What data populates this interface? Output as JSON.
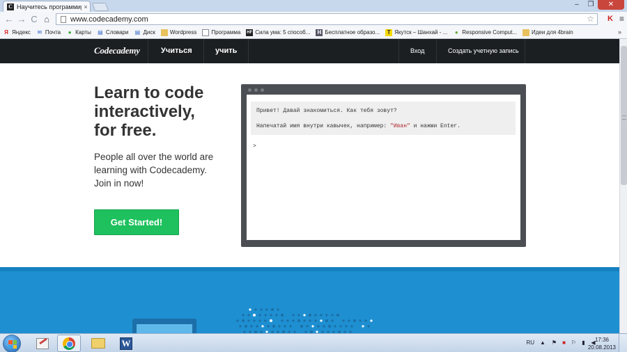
{
  "browser": {
    "tab_title": "Научитесь программиров",
    "tab_favicon": "C",
    "tab_close": "×",
    "url": "www.codecademy.com",
    "window_controls": [
      "–",
      "❐",
      "✕"
    ],
    "nav": {
      "back": "←",
      "forward": "→",
      "reload": "C",
      "home": "⌂"
    },
    "star": "☆",
    "ext_icon": "K",
    "menu_icon": "≡"
  },
  "bookmarks": [
    {
      "label": "Яндекс",
      "icon": "Я",
      "kind": "yandex"
    },
    {
      "label": "Почта",
      "icon": "✉",
      "kind": "page"
    },
    {
      "label": "Карты",
      "icon": "●",
      "kind": "maps"
    },
    {
      "label": "Словари",
      "icon": "▤",
      "kind": "page"
    },
    {
      "label": "Диск",
      "icon": "▤",
      "kind": "page"
    },
    {
      "label": "Wordpress",
      "icon": "",
      "kind": "folder"
    },
    {
      "label": "Программа",
      "icon": "",
      "kind": "page"
    },
    {
      "label": "Сила ума: 5 способ...",
      "icon": "HF",
      "kind": "hf"
    },
    {
      "label": "Бесплатное образо...",
      "icon": "H",
      "kind": "h"
    },
    {
      "label": "Якутск – Шанхай - ...",
      "icon": "T",
      "kind": "t"
    },
    {
      "label": "Responsive Comput...",
      "icon": "●",
      "kind": "rc"
    },
    {
      "label": "Идеи для 4brain",
      "icon": "",
      "kind": "folder"
    }
  ],
  "bookmarks_more": "»",
  "site": {
    "logo": "Codecademy",
    "nav_learn": "Учиться",
    "nav_teach": "учить",
    "login": "Вход",
    "signup": "Создать учетную запись"
  },
  "hero": {
    "title": "Learn to code\ninteractively,\nfor free.",
    "subtitle": "People all over the world are learning with Codecademy. Join in now!",
    "cta": "Get Started!"
  },
  "console": {
    "line1": "Привет! Давай знакомиться. Как тебя зовут?",
    "line2_prefix": "Напечатай имя внутри кавычек, например: ",
    "line2_highlight": "\"Иван\"",
    "line2_suffix": " и нажми Enter.",
    "prompt": ">"
  },
  "taskbar": {
    "lang": "RU",
    "time": "17:36",
    "date": "20.08.2013"
  }
}
